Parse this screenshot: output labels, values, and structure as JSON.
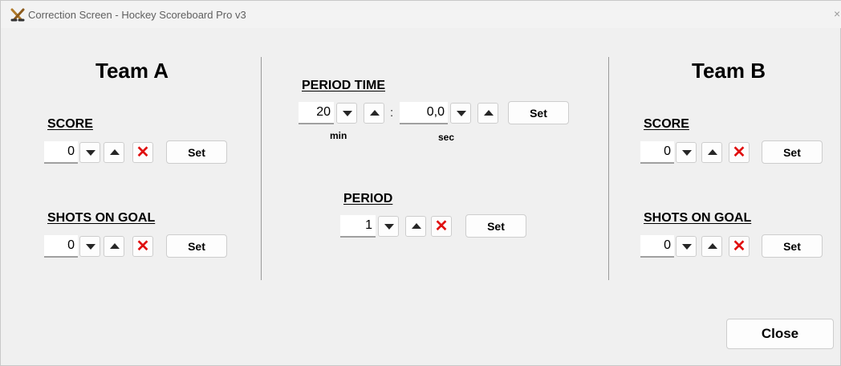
{
  "window": {
    "title": "Correction Screen - Hockey Scoreboard Pro v3",
    "close_glyph": "×"
  },
  "icons": {
    "app": "crossed-hockey-sticks-icon",
    "decrease": "chevron-down-icon",
    "increase": "chevron-up-icon",
    "reset": "red-x-icon"
  },
  "colors": {
    "reset_x": "#e01010",
    "background": "#f0f0f0"
  },
  "team_a": {
    "title": "Team A",
    "score": {
      "label": "SCORE",
      "value": "0",
      "set_label": "Set",
      "reset_glyph": "✕"
    },
    "shots": {
      "label": "SHOTS ON GOAL",
      "value": "0",
      "set_label": "Set",
      "reset_glyph": "✕"
    }
  },
  "center": {
    "period_time": {
      "label": "PERIOD TIME",
      "minutes": "20",
      "seconds": "0,0",
      "separator": ":",
      "min_label": "min",
      "sec_label": "sec",
      "set_label": "Set"
    },
    "period": {
      "label": "PERIOD",
      "value": "1",
      "set_label": "Set",
      "reset_glyph": "✕"
    }
  },
  "team_b": {
    "title": "Team B",
    "score": {
      "label": "SCORE",
      "value": "0",
      "set_label": "Set",
      "reset_glyph": "✕"
    },
    "shots": {
      "label": "SHOTS ON GOAL",
      "value": "0",
      "set_label": "Set",
      "reset_glyph": "✕"
    }
  },
  "footer": {
    "close_label": "Close"
  }
}
